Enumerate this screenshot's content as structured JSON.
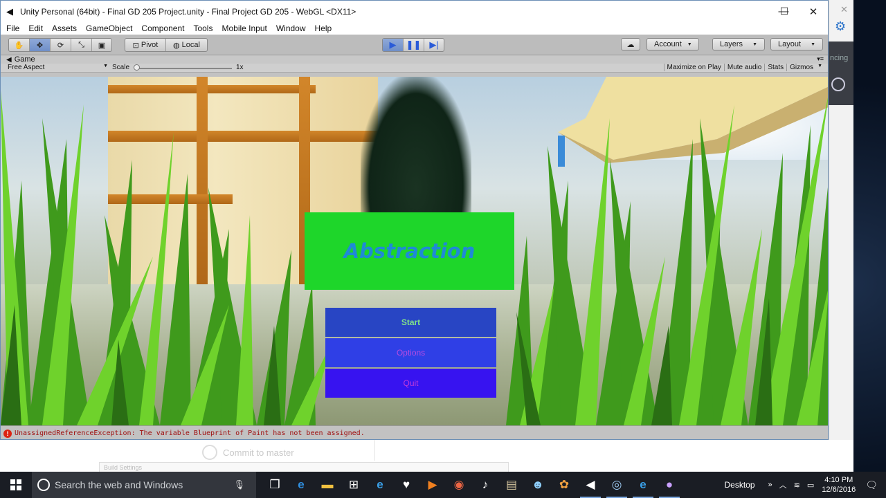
{
  "window": {
    "title": "Unity Personal (64bit) - Final GD 205 Project.unity - Final Project GD 205 - WebGL <DX11>",
    "minimize": "—",
    "maximize": "☐",
    "close": "✕"
  },
  "menu": [
    "File",
    "Edit",
    "Assets",
    "GameObject",
    "Component",
    "Tools",
    "Mobile Input",
    "Window",
    "Help"
  ],
  "toolbar": {
    "pivot": "Pivot",
    "local": "Local",
    "account": "Account",
    "layers": "Layers",
    "layout": "Layout"
  },
  "game_view": {
    "tab": "Game",
    "aspect": "Free Aspect",
    "scale_label": "Scale",
    "scale_value": "1x",
    "options": [
      "Maximize on Play",
      "Mute audio",
      "Stats",
      "Gizmos"
    ]
  },
  "game_menu": {
    "title": "Abstraction",
    "start": "Start",
    "options": "Options",
    "quit": "Quit"
  },
  "console": {
    "message": "UnassignedReferenceException: The variable Blueprint of Paint has not been assigned."
  },
  "background": {
    "commit": "Commit to master",
    "build": "Build Settings",
    "panel_text": "ncing"
  },
  "taskbar": {
    "search_placeholder": "Search the web and Windows",
    "desktop_label": "Desktop",
    "time": "4:10 PM",
    "date": "12/6/2016"
  }
}
